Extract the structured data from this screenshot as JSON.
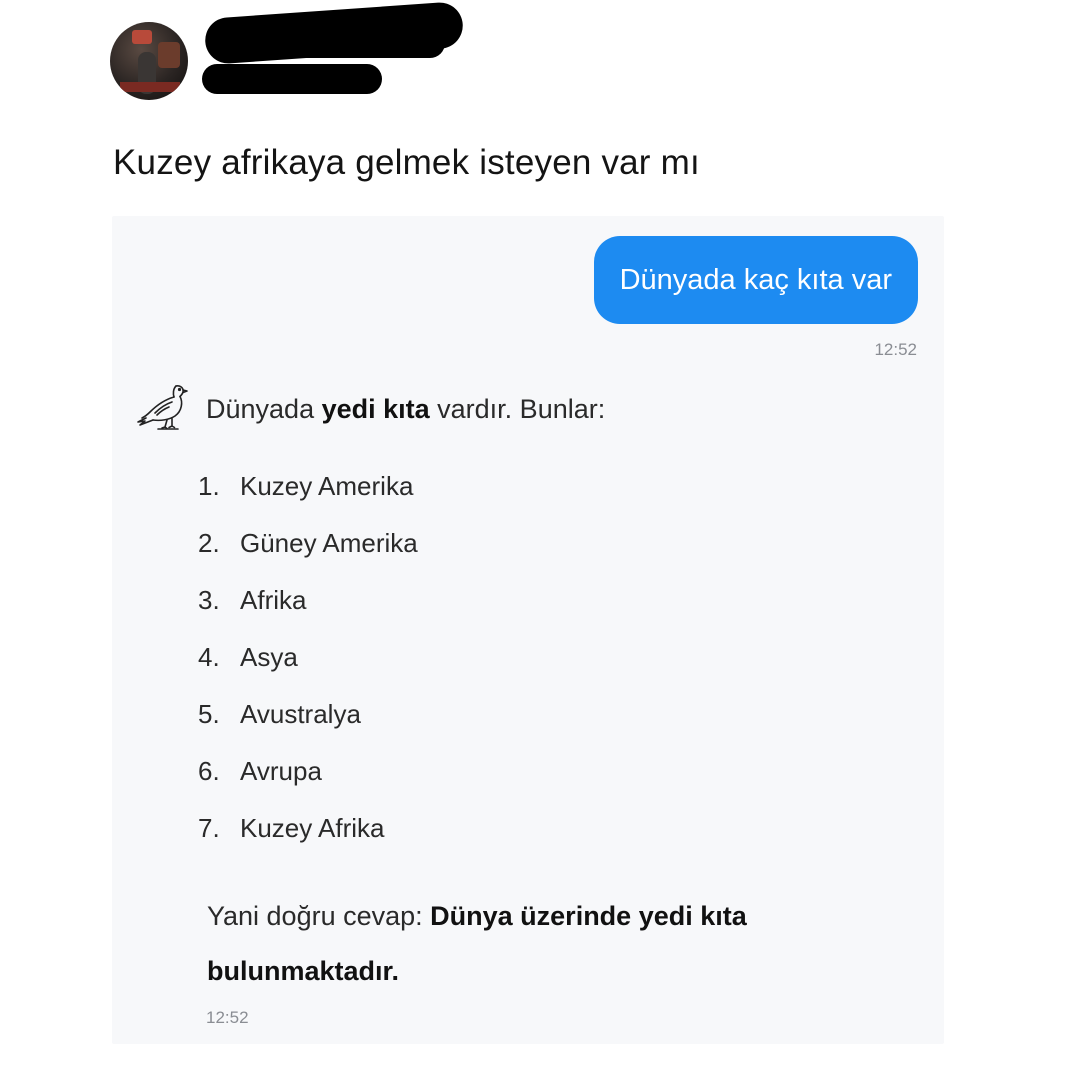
{
  "tweet": {
    "text": "Kuzey afrikaya gelmek isteyen var mı",
    "avatar_icon": "profile-avatar",
    "redaction_color": "#000000"
  },
  "chat": {
    "user_message": "Dünyada kaç kıta var",
    "user_time": "12:52",
    "bot_icon": "dove-icon",
    "bot_intro_prefix": "Dünyada ",
    "bot_intro_bold": "yedi kıta",
    "bot_intro_suffix": " vardır. Bunlar:",
    "continents": [
      {
        "num": "1.",
        "name": "Kuzey Amerika"
      },
      {
        "num": "2.",
        "name": "Güney Amerika"
      },
      {
        "num": "3.",
        "name": "Afrika"
      },
      {
        "num": "4.",
        "name": "Asya"
      },
      {
        "num": "5.",
        "name": "Avustralya"
      },
      {
        "num": "6.",
        "name": "Avrupa"
      },
      {
        "num": "7.",
        "name": "Kuzey Afrika"
      }
    ],
    "answer_prefix": "Yani doğru cevap: ",
    "answer_bold": "Dünya üzerinde yedi kıta bulunmaktadır.",
    "bot_time": "12:52",
    "colors": {
      "user_bubble": "#1d8bf1",
      "card_background": "#f7f8fa",
      "timestamp": "#8a8d93"
    }
  }
}
